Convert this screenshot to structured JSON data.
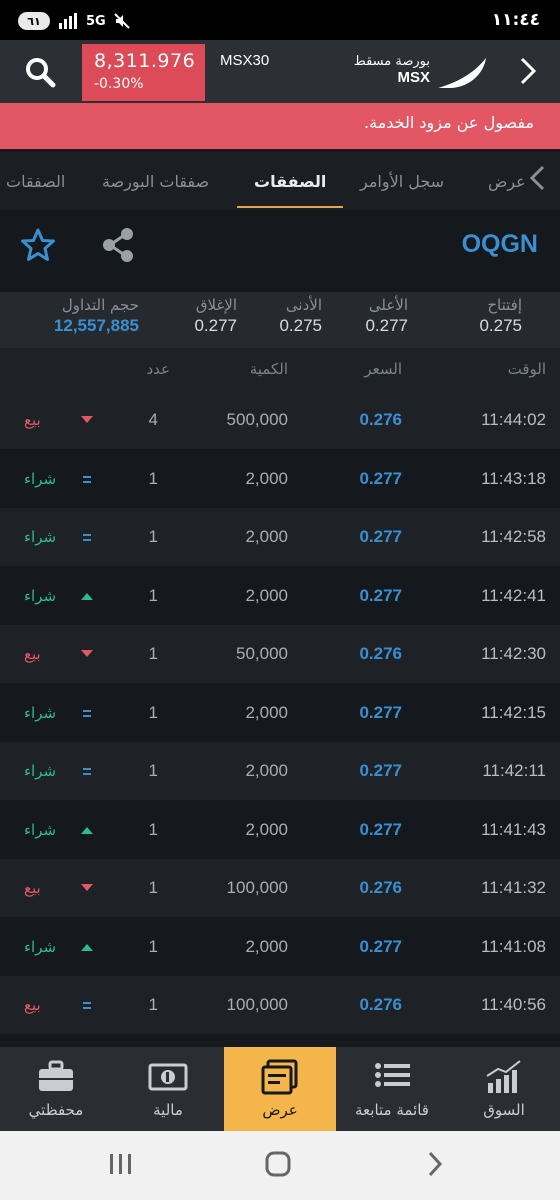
{
  "status_bar": {
    "battery": "٦١",
    "network": "5G",
    "time": "١١:٤٤",
    "signal_icon": "signal-bars-icon",
    "mute_icon": "mute-icon"
  },
  "header": {
    "index_value": "8,311.976",
    "index_change": "-0.30%",
    "index_name": "MSX30",
    "brand_ar": "بورصة مسقط",
    "brand_en": "MSX"
  },
  "banner": {
    "text": "مفصول عن مزود الخدمة."
  },
  "tabs": [
    {
      "label": "الصفقات"
    },
    {
      "label": "صفقات البورصة"
    },
    {
      "label": "الصفقات"
    },
    {
      "label": "سجل الأوامر"
    },
    {
      "label": "عرض"
    }
  ],
  "stock": {
    "symbol": "OQGN"
  },
  "stats": [
    {
      "label": "إفتتاح",
      "value": "0.275"
    },
    {
      "label": "الأعلى",
      "value": "0.277"
    },
    {
      "label": "الأدنى",
      "value": "0.275"
    },
    {
      "label": "الإغلاق",
      "value": "0.277"
    },
    {
      "label": "حجم التداول",
      "value": "12,557,885"
    }
  ],
  "table": {
    "headers": {
      "time": "الوقت",
      "price": "السعر",
      "quantity": "الكمية",
      "count": "عدد"
    },
    "rows": [
      {
        "time": "11:44:02",
        "price": "0.276",
        "quantity": "500,000",
        "count": "4",
        "indicator": "down",
        "side": "بيع"
      },
      {
        "time": "11:43:18",
        "price": "0.277",
        "quantity": "2,000",
        "count": "1",
        "indicator": "equal",
        "side": "شراء"
      },
      {
        "time": "11:42:58",
        "price": "0.277",
        "quantity": "2,000",
        "count": "1",
        "indicator": "equal",
        "side": "شراء"
      },
      {
        "time": "11:42:41",
        "price": "0.277",
        "quantity": "2,000",
        "count": "1",
        "indicator": "up",
        "side": "شراء"
      },
      {
        "time": "11:42:30",
        "price": "0.276",
        "quantity": "50,000",
        "count": "1",
        "indicator": "down",
        "side": "بيع"
      },
      {
        "time": "11:42:15",
        "price": "0.277",
        "quantity": "2,000",
        "count": "1",
        "indicator": "equal",
        "side": "شراء"
      },
      {
        "time": "11:42:11",
        "price": "0.277",
        "quantity": "2,000",
        "count": "1",
        "indicator": "equal",
        "side": "شراء"
      },
      {
        "time": "11:41:43",
        "price": "0.277",
        "quantity": "2,000",
        "count": "1",
        "indicator": "up",
        "side": "شراء"
      },
      {
        "time": "11:41:32",
        "price": "0.276",
        "quantity": "100,000",
        "count": "1",
        "indicator": "down",
        "side": "بيع"
      },
      {
        "time": "11:41:08",
        "price": "0.277",
        "quantity": "2,000",
        "count": "1",
        "indicator": "up",
        "side": "شراء"
      },
      {
        "time": "11:40:56",
        "price": "0.276",
        "quantity": "100,000",
        "count": "1",
        "indicator": "equal",
        "side": "بيع"
      }
    ]
  },
  "bottom_nav": [
    {
      "label": "محفظتي",
      "icon": "briefcase-icon"
    },
    {
      "label": "مالية",
      "icon": "money-icon"
    },
    {
      "label": "عرض",
      "icon": "display-window-icon"
    },
    {
      "label": "قائمة متابعة",
      "icon": "list-icon"
    },
    {
      "label": "السوق",
      "icon": "market-chart-icon"
    }
  ],
  "colors": {
    "accent_blue": "#3a8fd1",
    "sell_red": "#e35765",
    "buy_green": "#2cb899",
    "active_tab_underline": "#e8a545",
    "active_nav": "#f4b54a"
  }
}
